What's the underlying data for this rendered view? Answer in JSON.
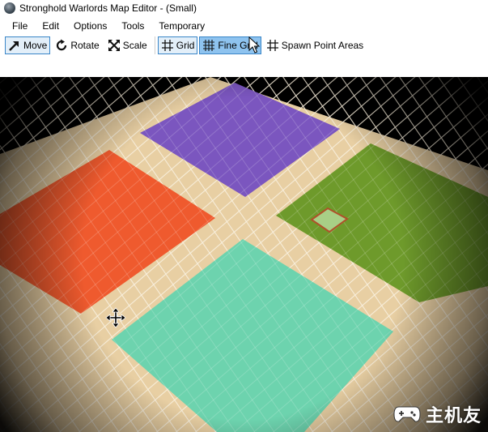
{
  "window": {
    "title": "Stronghold Warlords Map Editor - (Small)",
    "app_icon": "globe-icon"
  },
  "menu": {
    "items": [
      {
        "label": "File"
      },
      {
        "label": "Edit"
      },
      {
        "label": "Options"
      },
      {
        "label": "Tools"
      },
      {
        "label": "Temporary"
      }
    ]
  },
  "toolbar": {
    "move_label": "Move",
    "rotate_label": "Rotate",
    "scale_label": "Scale",
    "grid_label": "Grid",
    "fine_grid_label": "Fine Grid",
    "spawn_label": "Spawn Point Areas",
    "active": [
      "Move",
      "Grid",
      "Fine Grid"
    ]
  },
  "viewport": {
    "colors": {
      "ground": "#e8cfa3",
      "grid_line": "#f6ead3",
      "purple_area": "#7b56bf",
      "green_area": "#6e9a2b",
      "red_area": "#ef5a2e",
      "teal_area": "#6dd3ae",
      "marker_fill": "#a8cf86",
      "marker_border": "#b0502a"
    },
    "cursor_icon": "move-cursor-icon"
  },
  "watermark": {
    "text": "主机友",
    "icon": "gamepad-icon"
  }
}
